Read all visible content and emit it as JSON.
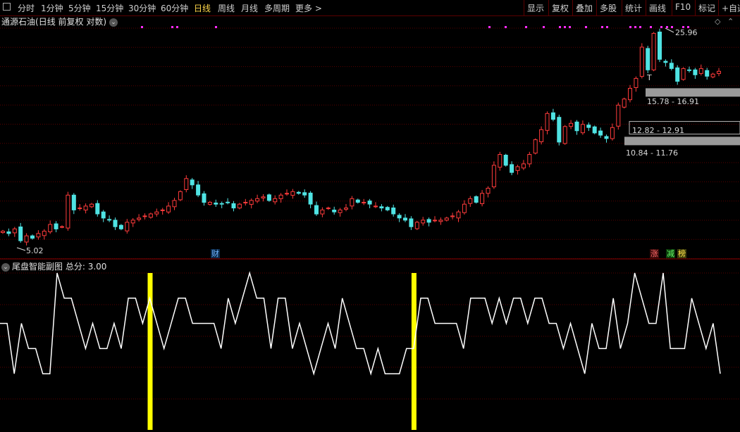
{
  "toolbar": {
    "left_items": [
      "分时",
      "1分钟",
      "5分钟",
      "15分钟",
      "30分钟",
      "60分钟",
      "日线",
      "周线",
      "月线",
      "多周期",
      "更多 >"
    ],
    "active_item": "日线",
    "right_items": [
      "显示",
      "复权",
      "叠加",
      "多股",
      "统计",
      "画线",
      "F10",
      "标记",
      "+自选"
    ]
  },
  "stock": {
    "name": "通源石油",
    "mode": "(日线 前复权 对数)"
  },
  "annotations": {
    "high_label": "25.96",
    "low_label": "5.02",
    "zone1_label": "15.78 - 16.91",
    "zone2_label": "12.82 - 12.91",
    "zone3_label": "10.84 - 11.76",
    "small_t": "T"
  },
  "badges": {
    "cai": "财",
    "zhang": "涨",
    "jian": "减",
    "bang": "榜"
  },
  "sub_indicator": {
    "name": "尾盘智能副图",
    "score_label": "总分:",
    "score_value": "3.00"
  },
  "colors": {
    "up": "#ff3b3b",
    "down": "#4fe3e3",
    "grid": "#5a0000",
    "signal": "#ffff00",
    "marker": "#ff2bff",
    "zone": "#9a9a9a"
  },
  "chart_data": [
    {
      "type": "candlestick",
      "title": "通源石油 日线",
      "price_range": [
        5.02,
        25.96
      ],
      "closes": [
        5.8,
        5.7,
        5.9,
        5.4,
        5.6,
        5.5,
        5.7,
        5.8,
        6.1,
        5.9,
        6.0,
        7.6,
        6.8,
        6.9,
        7.0,
        7.1,
        6.6,
        6.4,
        6.3,
        6.0,
        5.9,
        6.2,
        6.3,
        6.4,
        6.5,
        6.6,
        6.7,
        6.8,
        7.0,
        7.3,
        7.8,
        8.6,
        8.2,
        7.6,
        7.2,
        7.2,
        7.1,
        7.1,
        7.2,
        6.9,
        7.1,
        7.2,
        7.3,
        7.4,
        7.5,
        7.3,
        7.4,
        7.6,
        7.7,
        7.8,
        7.7,
        7.6,
        7.1,
        6.6,
        6.8,
        6.9,
        6.7,
        6.8,
        6.9,
        7.4,
        7.2,
        7.2,
        7.1,
        7.0,
        6.9,
        6.8,
        6.6,
        6.4,
        6.3,
        6.0,
        6.2,
        6.3,
        6.2,
        6.3,
        6.3,
        6.4,
        6.5,
        6.7,
        7.1,
        7.4,
        7.2,
        7.7,
        8.0,
        9.5,
        10.3,
        9.5,
        9.0,
        9.4,
        9.6,
        10.3,
        11.5,
        12.4,
        14.0,
        13.4,
        11.3,
        12.7,
        13.0,
        12.3,
        12.9,
        12.6,
        12.1,
        11.9,
        11.6,
        12.6,
        14.9,
        15.6,
        16.9,
        18.2,
        23.0,
        19.4,
        25.5,
        21.0,
        20.5,
        19.6,
        17.8,
        19.6,
        19.4,
        18.7,
        19.6,
        18.5,
        18.8,
        19.2
      ],
      "high": 25.96,
      "low": 5.02
    },
    {
      "type": "line",
      "title": "尾盘智能副图",
      "series": [
        {
          "name": "",
          "values": [
            3,
            3,
            1,
            3,
            2,
            2,
            1,
            1,
            5,
            4,
            4,
            3,
            2,
            3,
            2,
            2,
            3,
            2,
            4,
            4,
            3,
            4,
            3,
            2,
            3,
            4,
            4,
            3,
            3,
            3,
            3,
            2,
            4,
            3,
            4,
            5,
            4,
            4,
            2,
            4,
            4,
            2,
            3,
            2,
            1,
            2,
            3,
            2,
            4,
            3,
            2,
            2,
            1,
            2,
            1,
            1,
            1,
            2,
            2,
            4,
            4,
            3,
            3,
            3,
            3,
            2,
            4,
            4,
            4,
            3,
            4,
            3,
            4,
            4,
            3,
            4,
            4,
            3,
            3,
            2,
            3,
            2,
            1,
            3,
            2,
            2,
            4,
            2,
            3,
            5,
            4,
            3,
            3,
            5,
            2,
            2,
            2,
            4,
            3,
            2,
            3,
            1
          ]
        }
      ],
      "signals_at": [
        21,
        58
      ],
      "yrange": [
        0,
        5
      ]
    }
  ]
}
